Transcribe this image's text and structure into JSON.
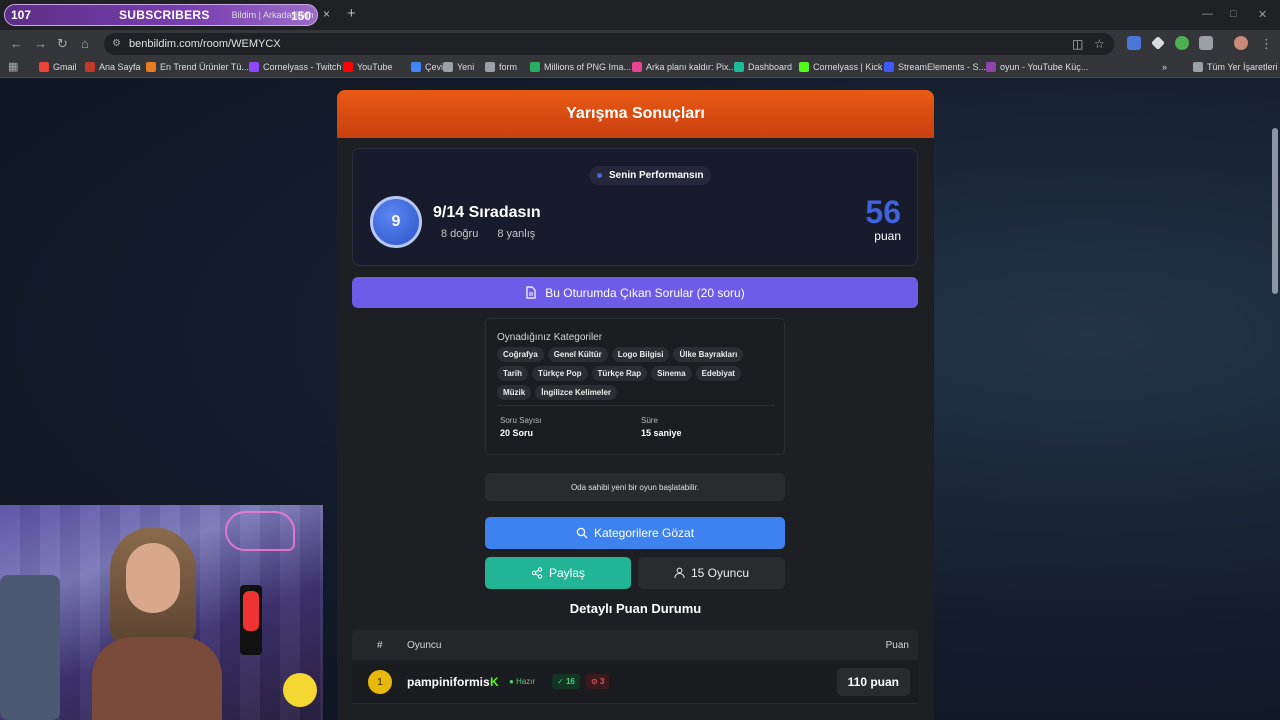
{
  "overlay": {
    "count_left": "107",
    "label": "SUBSCRIBERS",
    "tab_title": "Bildim | Arkadaşların",
    "count_right": "150"
  },
  "browser": {
    "tab_close": "×",
    "tab_new": "+",
    "url": "benbildim.com/room/WEMYCX",
    "bookmarks": [
      {
        "label": "Gmail",
        "color": "#ea4335"
      },
      {
        "label": "Ana Sayfa",
        "color": "#c0392b"
      },
      {
        "label": "En Trend Ürünler Tü...",
        "color": "#e67e22"
      },
      {
        "label": "Cornelyass - Twitch",
        "color": "#9146ff"
      },
      {
        "label": "YouTube",
        "color": "#ff0000"
      },
      {
        "label": "Çevir",
        "color": "#4285f4"
      },
      {
        "label": "Yeni",
        "color": "#9aa0a6"
      },
      {
        "label": "form",
        "color": "#9aa0a6"
      },
      {
        "label": "Millions of PNG Ima...",
        "color": "#27ae60"
      },
      {
        "label": "Arka planı kaldır: Pix...",
        "color": "#e84393"
      },
      {
        "label": "Dashboard",
        "color": "#1abc9c"
      },
      {
        "label": "Cornelyass | Kick",
        "color": "#53fc18"
      },
      {
        "label": "StreamElements - S...",
        "color": "#3d5afe"
      },
      {
        "label": "oyun - YouTube Küç...",
        "color": "#8e44ad"
      }
    ],
    "all_bookmarks": "Tüm Yer İşaretleri"
  },
  "results": {
    "header_title": "Yarışma Sonuçları",
    "perf_label": "Senin Performansın",
    "rank_number": "9",
    "rank_title": "9/14 Sıradasın",
    "correct": "8 doğru",
    "wrong": "8 yanlış",
    "score": "56",
    "score_unit": "puan",
    "questions_button": "Bu Oturumda Çıkan Sorular (20 soru)",
    "categories_title": "Oynadığınız Kategoriler",
    "categories": [
      "Coğrafya",
      "Genel Kültür",
      "Logo Bilgisi",
      "Ülke Bayrakları",
      "Tarih",
      "Türkçe Pop",
      "Türkçe Rap",
      "Sinema",
      "Edebiyat",
      "Müzik",
      "İngilizce Kelimeler"
    ],
    "question_count_label": "Soru Sayısı",
    "question_count_value": "20 Soru",
    "duration_label": "Süre",
    "duration_value": "15 saniye",
    "notice": "Oda sahibi yeni bir oyun başlatabilir.",
    "browse_button": "Kategorilere Gözat",
    "share_button": "Paylaş",
    "players_button": "15 Oyuncu",
    "detail_title": "Detaylı Puan Durumu",
    "table": {
      "col_rank": "#",
      "col_player": "Oyuncu",
      "col_points": "Puan",
      "rows": [
        {
          "rank": "1",
          "name": "pampiniformis",
          "status": "Hazır",
          "correct": "16",
          "wrong": "3",
          "points": "110 puan"
        }
      ]
    }
  }
}
